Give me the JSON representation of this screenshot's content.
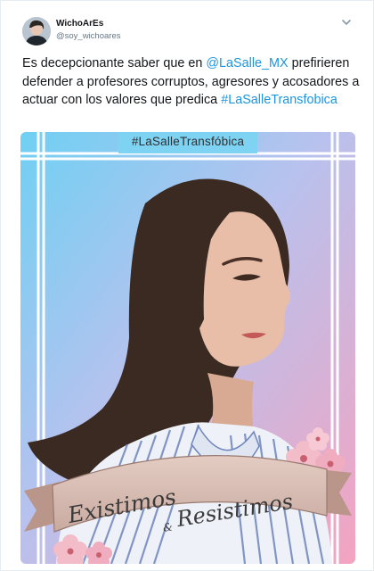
{
  "author": {
    "display_name": "WichoArEs",
    "handle": "@soy_wichoares"
  },
  "tweet": {
    "text_before_mention": "Es decepcionante saber que en ",
    "mention": "@LaSalle_MX",
    "text_after_mention": " prefirieren defender a profesores corruptos, agresores y acosadores a actuar con los valores que predica ",
    "hashtag": "#LaSalleTransfobica"
  },
  "image": {
    "banner_text": "#LaSalleTransfóbica",
    "ribbon_word_1": "Existimos",
    "ribbon_amp": "&",
    "ribbon_word_2": "Resistimos"
  },
  "icons": {
    "more": "chevron-down-icon",
    "avatar": "avatar"
  },
  "colors": {
    "link": "#1b95e0",
    "sky": "#6fc8ee",
    "pink": "#f2a6bf",
    "hair": "#3a2a22"
  }
}
